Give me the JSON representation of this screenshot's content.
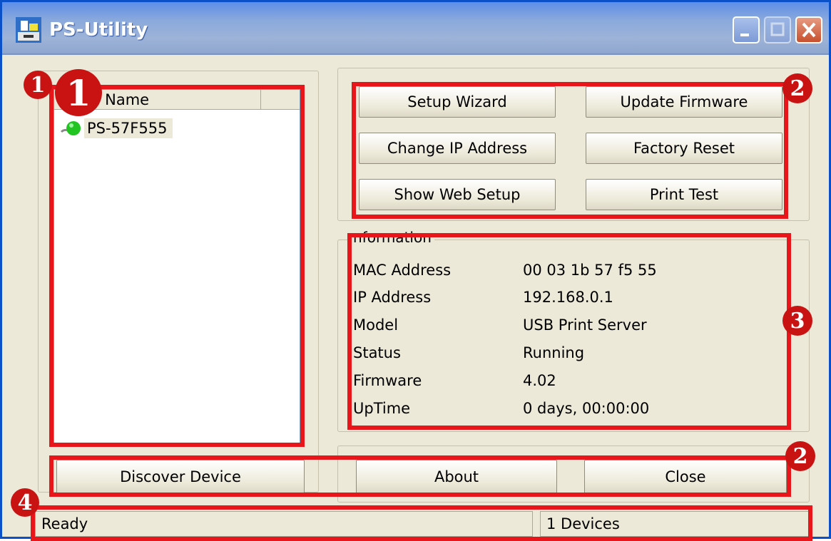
{
  "window": {
    "title": "PS-Utility"
  },
  "device_list": {
    "column_header": "ce Name",
    "devices": [
      {
        "name": "PS-57F555",
        "status_color": "#22c422"
      }
    ]
  },
  "actions": {
    "setup_wizard": "Setup Wizard",
    "update_firmware": "Update Firmware",
    "change_ip": "Change IP Address",
    "factory_reset": "Factory Reset",
    "show_web_setup": "Show Web Setup",
    "print_test": "Print Test"
  },
  "information": {
    "legend": "nformation",
    "rows": [
      {
        "label": "MAC Address",
        "value": "00 03 1b 57 f5 55"
      },
      {
        "label": "IP Address",
        "value": "192.168.0.1"
      },
      {
        "label": "Model",
        "value": "USB Print Server"
      },
      {
        "label": "Status",
        "value": "Running"
      },
      {
        "label": "Firmware",
        "value": "4.02"
      },
      {
        "label": "UpTime",
        "value": "0 days, 00:00:00"
      }
    ]
  },
  "bottom_buttons": {
    "discover": "Discover Device",
    "about": "About",
    "close": "Close"
  },
  "statusbar": {
    "status": "Ready",
    "count": "1 Devices"
  },
  "annotations": {
    "badge_1_large": "1",
    "badge_1_small": "1",
    "badge_2_top": "2",
    "badge_2_bottom": "2",
    "badge_3": "3",
    "badge_4": "4",
    "highlight_color": "#e8161b"
  }
}
